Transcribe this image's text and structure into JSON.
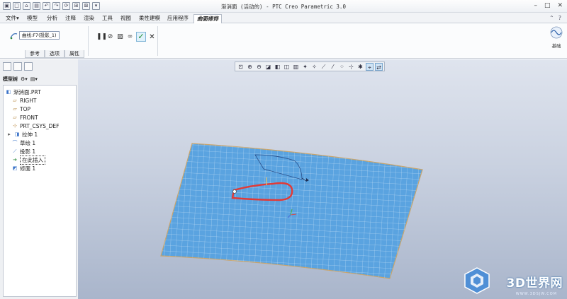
{
  "title": "渐消面 (活动的) - PTC Creo Parametric 3.0",
  "menu": {
    "file": "文件",
    "tabs": [
      "模型",
      "分析",
      "注释",
      "渲染",
      "工具",
      "视图",
      "柔性建模",
      "应用程序"
    ],
    "active_tab": "曲面修饰"
  },
  "ribbon": {
    "reference_value": "曲线:F7(投影_1)",
    "subtabs": [
      "参考",
      "选项",
      "属性"
    ],
    "base_curve_label": "基础"
  },
  "model_tree": {
    "label": "模型树",
    "items": [
      {
        "label": "渐消面.PRT",
        "icon": "part-icon"
      },
      {
        "label": "RIGHT",
        "icon": "datum-plane-icon"
      },
      {
        "label": "TOP",
        "icon": "datum-plane-icon"
      },
      {
        "label": "FRONT",
        "icon": "datum-plane-icon"
      },
      {
        "label": "PRT_CSYS_DEF",
        "icon": "csys-icon"
      },
      {
        "label": "拉伸 1",
        "icon": "extrude-icon"
      },
      {
        "label": "草绘 1",
        "icon": "sketch-icon"
      },
      {
        "label": "投影 1",
        "icon": "projection-icon"
      },
      {
        "label": "在此插入",
        "icon": "insert-arrow-icon"
      },
      {
        "label": "修面 1",
        "icon": "feature-icon"
      }
    ]
  },
  "watermark": {
    "text": "3D世界网",
    "sub": "WWW.3DSJW.COM"
  },
  "colors": {
    "surface_fill": "#5aa3e0",
    "surface_grid": "#cfe6f7",
    "curve_red": "#e23a36",
    "accent_green": "#1a8a2a"
  }
}
